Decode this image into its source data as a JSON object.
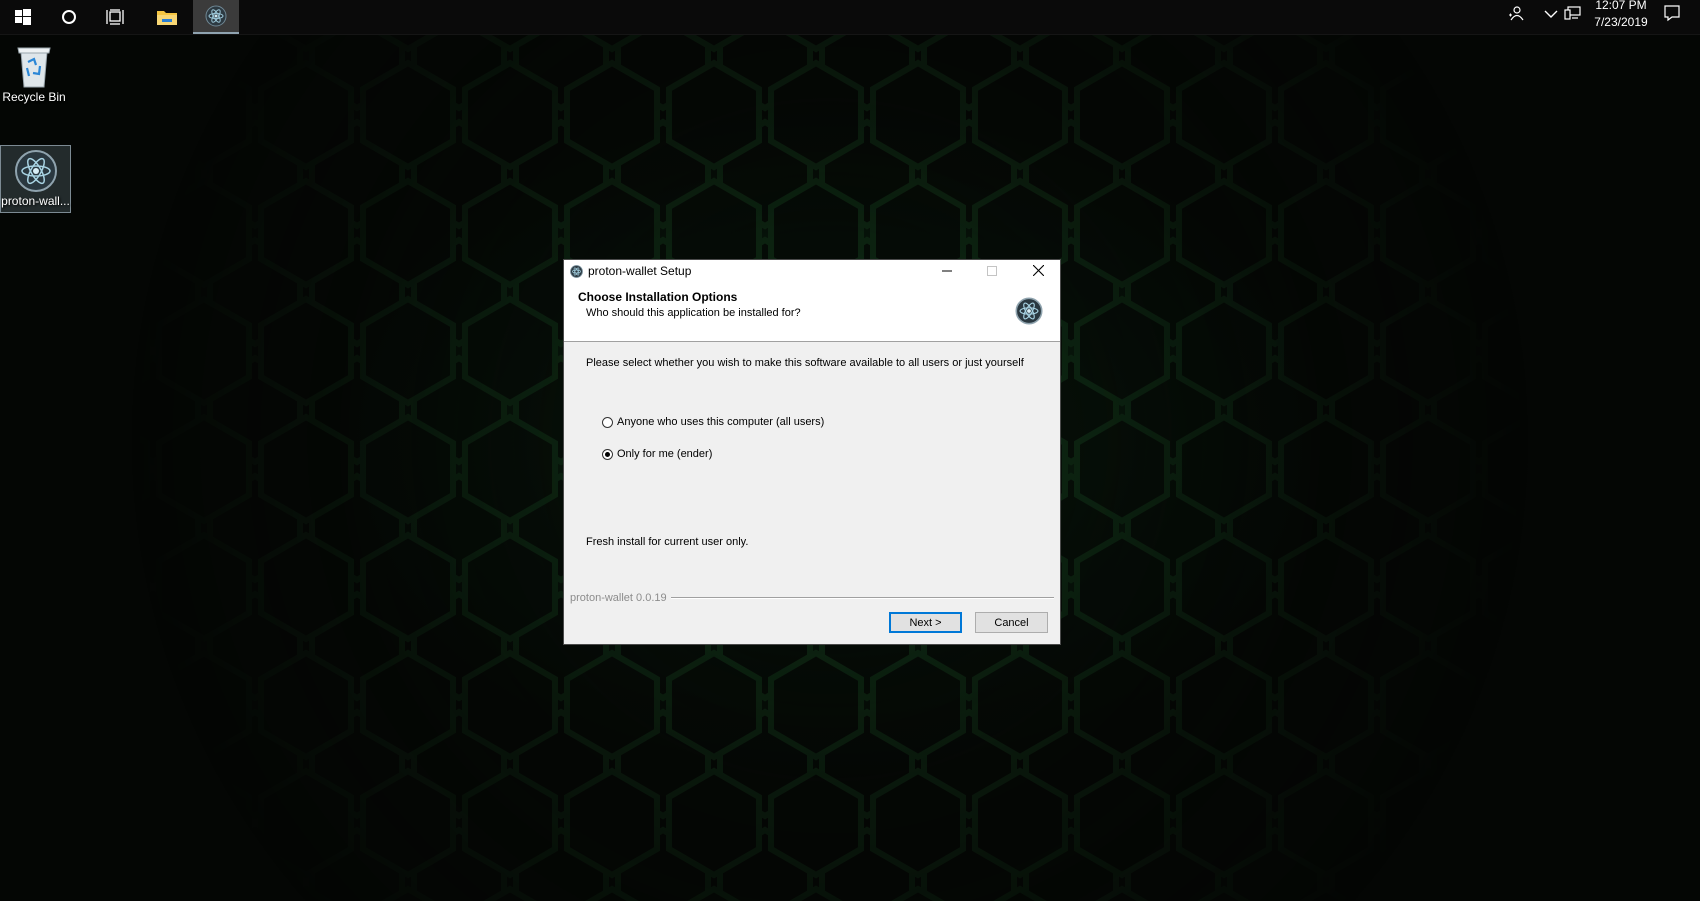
{
  "taskbar": {
    "clock_time": "12:07 PM",
    "clock_date": "7/23/2019",
    "buttons": [
      "start-icon",
      "cortana-icon",
      "task-view-icon",
      "file-explorer-icon",
      "proton-wallet-icon"
    ],
    "tray_icons": [
      "people-icon",
      "chevron-up-icon",
      "network-icon",
      "notification-icon"
    ]
  },
  "desktop": {
    "icons": [
      {
        "label": "Recycle Bin",
        "icon": "recycle-bin-icon"
      },
      {
        "label": "proton-wall...",
        "icon": "proton-wallet-icon"
      }
    ]
  },
  "installer": {
    "title": "proton-wallet Setup",
    "header_title": "Choose Installation Options",
    "header_subtitle": "Who should this application be installed for?",
    "body_text": "Please select whether you wish to make this software available to all users or just yourself",
    "options": [
      {
        "label": "Anyone who uses this computer (all users)",
        "checked": false
      },
      {
        "label": "Only for me (ender)",
        "checked": true
      }
    ],
    "status_text": "Fresh install for current user only.",
    "branding": "proton-wallet 0.0.19",
    "next_label": "Next >",
    "cancel_label": "Cancel"
  },
  "colors": {
    "accent": "#0078d7",
    "desktop_glow": "#14461f",
    "taskbar": "#0a0a0a",
    "dialog_bg": "#f0f0f0"
  }
}
